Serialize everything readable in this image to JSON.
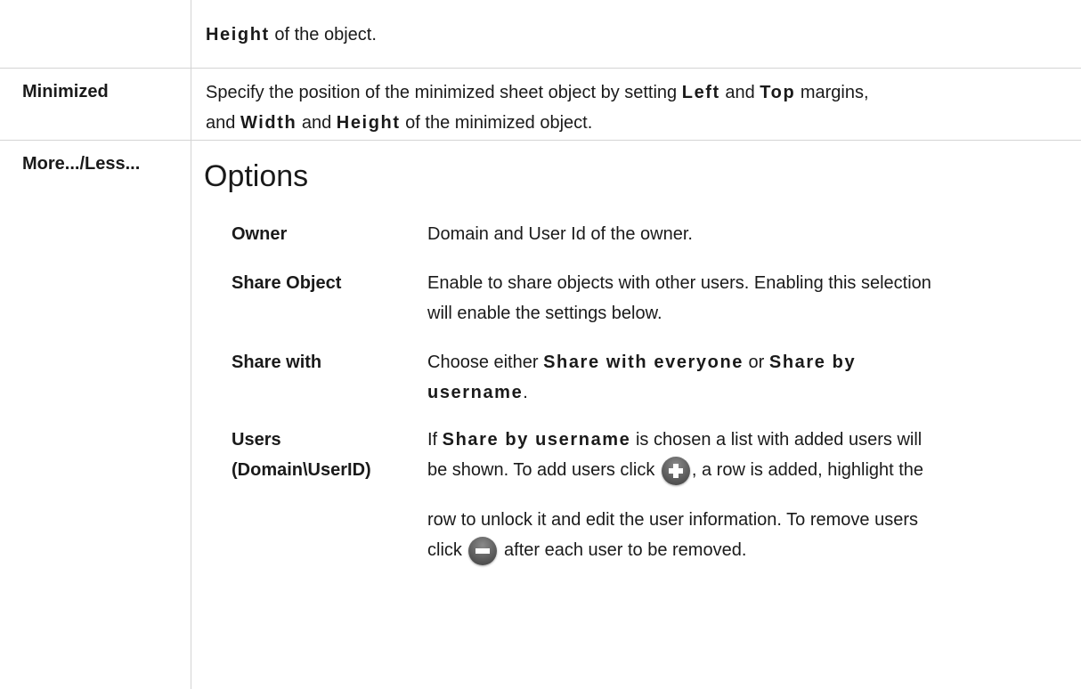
{
  "rows": [
    {
      "label": "",
      "desc_parts": [
        {
          "t": "Height",
          "b": true
        },
        {
          "t": " of the object.",
          "b": false
        }
      ]
    },
    {
      "label": "Minimized",
      "line1": [
        {
          "t": "Specify the position of the minimized sheet object by setting ",
          "b": false
        },
        {
          "t": "Left",
          "b": true
        },
        {
          "t": " and ",
          "b": false
        },
        {
          "t": "Top",
          "b": true
        },
        {
          "t": " margins,",
          "b": false
        }
      ],
      "line2": [
        {
          "t": "and ",
          "b": false
        },
        {
          "t": "Width",
          "b": true
        },
        {
          "t": " and ",
          "b": false
        },
        {
          "t": "Height",
          "b": true
        },
        {
          "t": " of the minimized object.",
          "b": false
        }
      ]
    },
    {
      "label": "More.../Less...",
      "heading": "Options"
    }
  ],
  "options": {
    "owner": {
      "label": "Owner",
      "desc": "Domain and User Id of the owner."
    },
    "share_object": {
      "label": "Share Object",
      "desc_line1": "Enable to share objects with other users. Enabling this selection",
      "desc_line2": "will enable the settings below."
    },
    "share_with": {
      "label": "Share with",
      "pre": "Choose either ",
      "opt1": "Share with everyone",
      "mid": " or ",
      "opt2a": "Share by",
      "opt2b": "username",
      "end": "."
    },
    "users": {
      "label_line1": "Users",
      "label_line2": "(Domain\\UserID)",
      "l1_pre": "If ",
      "l1_bold": "Share by username",
      "l1_post": " is chosen a list with added users will",
      "l2_pre": "be shown. To add users click ",
      "l2_post": ", a row is added, highlight the",
      "l3": "row to unlock it and edit the user information. To remove users",
      "l4_pre": "click ",
      "l4_post": " after each user to be removed.",
      "add_icon": "plus-circle-icon",
      "remove_icon": "minus-circle-icon"
    }
  }
}
